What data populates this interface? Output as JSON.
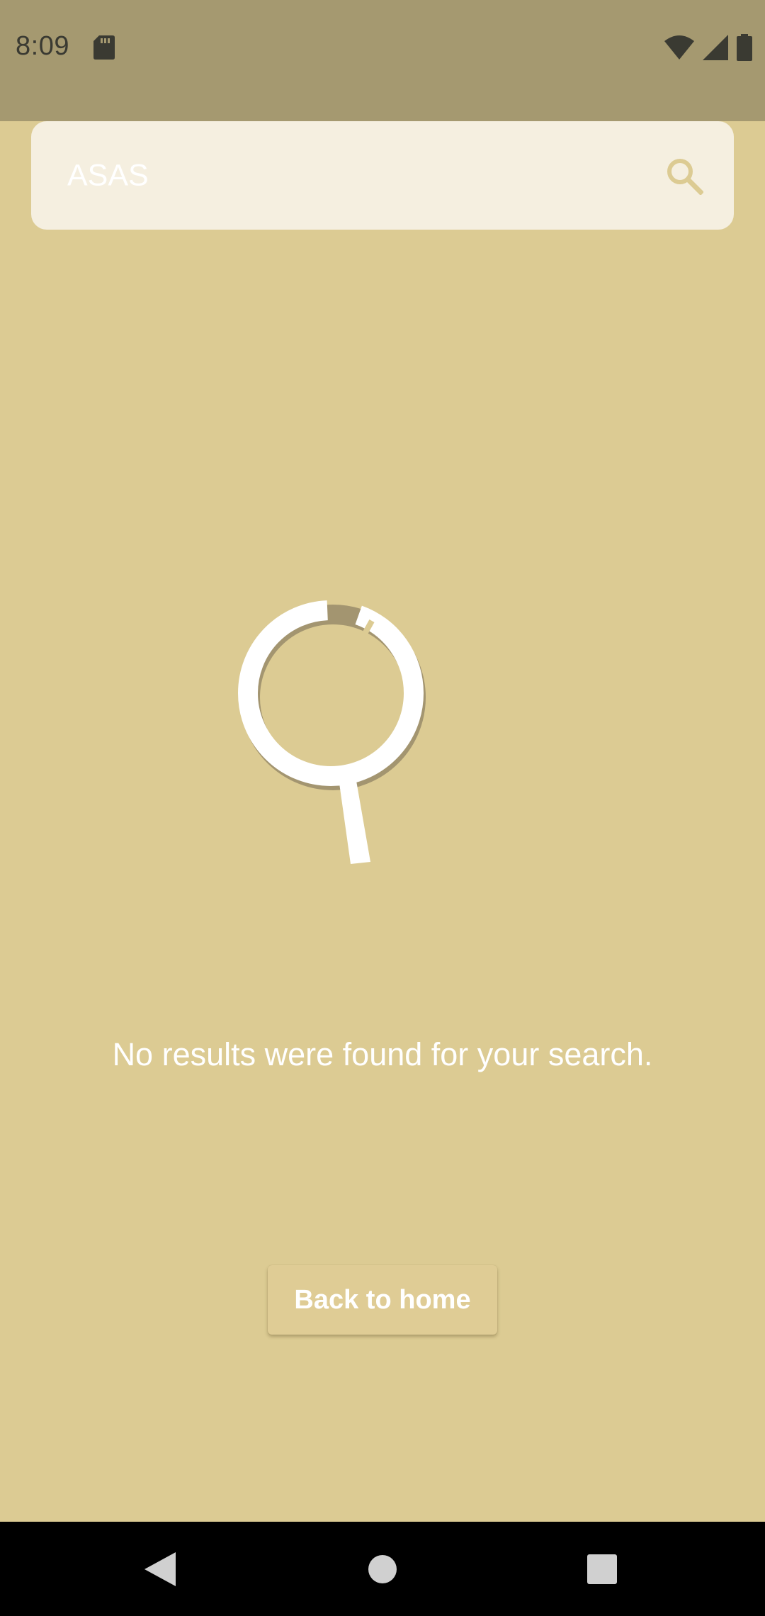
{
  "status_bar": {
    "time": "8:09",
    "icons": [
      "sd-card-icon",
      "wifi-icon",
      "cellular-signal-icon",
      "battery-icon"
    ]
  },
  "search": {
    "query": "ASAS",
    "icon": "search-icon"
  },
  "empty_state": {
    "illustration": "magnifier-illustration",
    "message": "No results were found for your search."
  },
  "actions": {
    "back_label": "Back to home"
  },
  "nav_bar": {
    "icons": [
      "back-icon",
      "home-icon",
      "recents-icon"
    ]
  },
  "colors": {
    "background": "#dccb93",
    "status_bar": "#a59970",
    "search_bar": "#f5efe0",
    "accent": "#dfcc95",
    "text": "#ffffff"
  }
}
